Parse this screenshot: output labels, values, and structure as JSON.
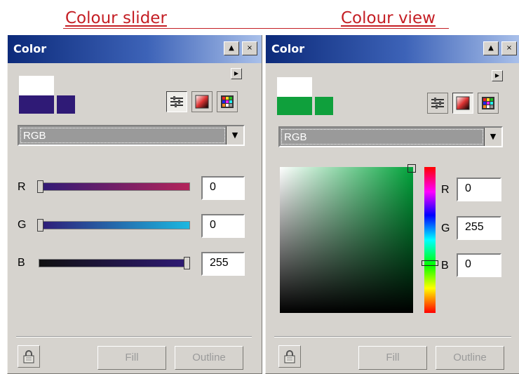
{
  "captions": {
    "left": "Colour slider",
    "right": "Colour view"
  },
  "panels": {
    "slider": {
      "title": "Color",
      "mode": "RGB",
      "colors": {
        "reference": "#ffffff",
        "current": "#2f1a76"
      },
      "channels": [
        {
          "label": "R",
          "value": "0",
          "level": 0
        },
        {
          "label": "G",
          "value": "0",
          "level": 0
        },
        {
          "label": "B",
          "value": "255",
          "level": 1
        }
      ],
      "buttons": {
        "fill": "Fill",
        "outline": "Outline"
      },
      "icons": [
        "scroll-up-icon",
        "close-icon",
        "flyout-arrow-icon",
        "slider-mode-icon",
        "viewer-mode-icon",
        "palette-mode-icon",
        "dropdown-arrow-icon",
        "lock-icon"
      ]
    },
    "viewer": {
      "title": "Color",
      "mode": "RGB",
      "colors": {
        "reference": "#ffffff",
        "current": "#0fa03c"
      },
      "channels": [
        {
          "label": "R",
          "value": "0"
        },
        {
          "label": "G",
          "value": "255"
        },
        {
          "label": "B",
          "value": "0"
        }
      ],
      "buttons": {
        "fill": "Fill",
        "outline": "Outline"
      },
      "icons": [
        "scroll-up-icon",
        "close-icon",
        "flyout-arrow-icon",
        "slider-mode-icon",
        "viewer-mode-icon",
        "palette-mode-icon",
        "dropdown-arrow-icon",
        "lock-icon"
      ]
    }
  }
}
